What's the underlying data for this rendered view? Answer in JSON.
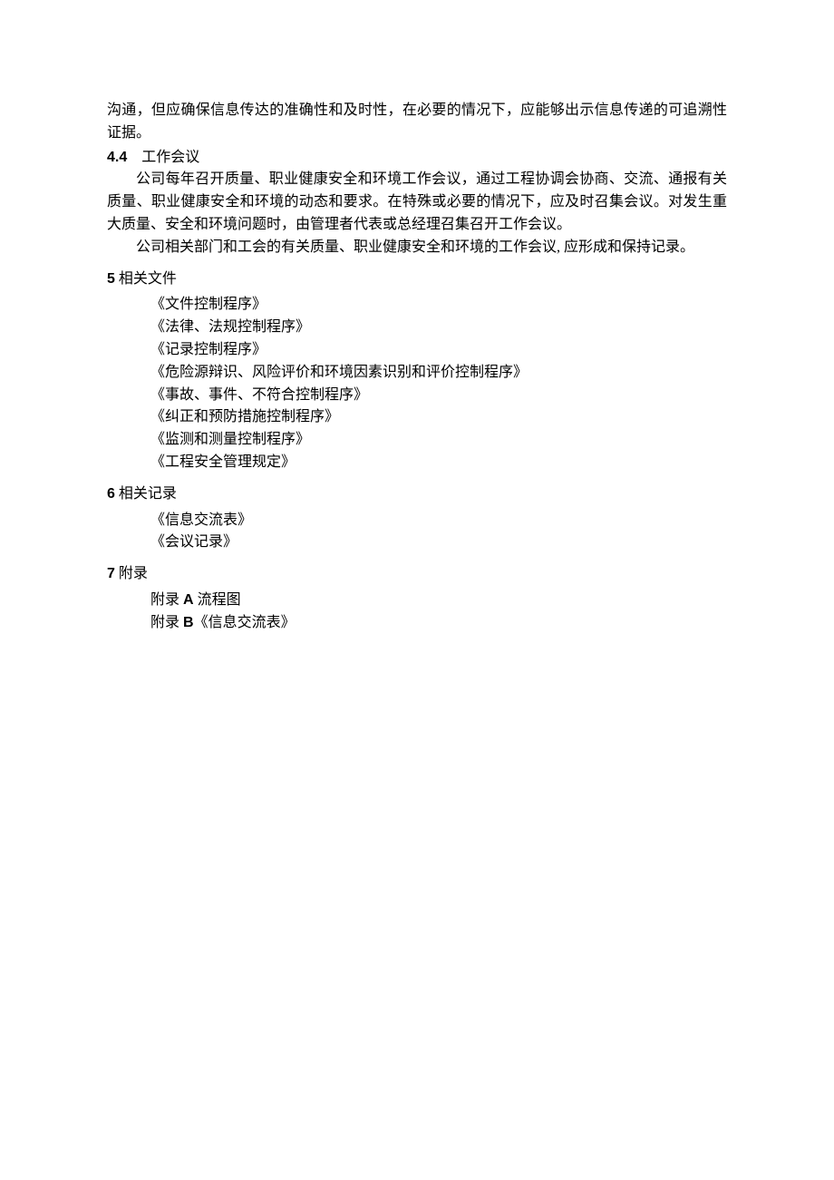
{
  "para1": "沟通，但应确保信息传达的准确性和及时性，在必要的情况下，应能够出示信息传递的可追溯性证据。",
  "sec44": {
    "num": "4.4",
    "title": "工作会议",
    "p1": "公司每年召开质量、职业健康安全和环境工作会议，通过工程协调会协商、交流、通报有关质量、职业健康安全和环境的动态和要求。在特殊或必要的情况下，应及时召集会议。对发生重大质量、安全和环境问题时，由管理者代表或总经理召集召开工作会议。",
    "p2": "公司相关部门和工会的有关质量、职业健康安全和环境的工作会议, 应形成和保持记录。"
  },
  "sec5": {
    "num": "5",
    "title": " 相关文件",
    "items": [
      "《文件控制程序》",
      "《法律、法规控制程序》",
      "《记录控制程序》",
      "《危险源辩识、风险评价和环境因素识别和评价控制程序》",
      "《事故、事件、不符合控制程序》",
      "《纠正和预防措施控制程序》",
      "《监测和测量控制程序》",
      "《工程安全管理规定》"
    ]
  },
  "sec6": {
    "num": "6",
    "title": " 相关记录",
    "items": [
      "《信息交流表》",
      "《会议记录》"
    ]
  },
  "sec7": {
    "num": "7",
    "title": " 附录",
    "items": [
      {
        "prefix": "附录 ",
        "letter": "A",
        "suffix": " 流程图"
      },
      {
        "prefix": "附录 ",
        "letter": "B",
        "suffix": "《信息交流表》"
      }
    ]
  }
}
